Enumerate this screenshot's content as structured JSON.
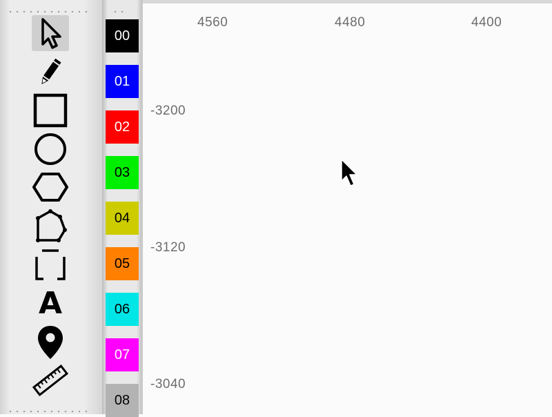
{
  "tools": [
    {
      "id": "select",
      "icon": "arrow-pointer-icon",
      "selected": true
    },
    {
      "id": "pencil",
      "icon": "pencil-icon",
      "selected": false
    },
    {
      "id": "rectangle",
      "icon": "square-icon",
      "selected": false
    },
    {
      "id": "circle",
      "icon": "circle-icon",
      "selected": false
    },
    {
      "id": "hexagon",
      "icon": "hexagon-icon",
      "selected": false
    },
    {
      "id": "polygon",
      "icon": "polygon-icon",
      "selected": false
    },
    {
      "id": "bracket",
      "icon": "bracket-icon",
      "selected": false
    },
    {
      "id": "text",
      "icon": "text-a-icon",
      "label": "A",
      "selected": false
    },
    {
      "id": "marker",
      "icon": "map-pin-icon",
      "selected": false
    },
    {
      "id": "measure",
      "icon": "ruler-icon",
      "selected": false
    }
  ],
  "palette": [
    {
      "label": "00",
      "bg": "#000000",
      "fg": "#ffffff"
    },
    {
      "label": "01",
      "bg": "#0000ff",
      "fg": "#ffffff"
    },
    {
      "label": "02",
      "bg": "#ff0000",
      "fg": "#ffffff"
    },
    {
      "label": "03",
      "bg": "#00ee00",
      "fg": "#000000"
    },
    {
      "label": "04",
      "bg": "#cccc00",
      "fg": "#000000"
    },
    {
      "label": "05",
      "bg": "#ff7f00",
      "fg": "#000000"
    },
    {
      "label": "06",
      "bg": "#00e5e5",
      "fg": "#000000"
    },
    {
      "label": "07",
      "bg": "#ff00ff",
      "fg": "#ffffff"
    },
    {
      "label": "08",
      "bg": "#b3b3b3",
      "fg": "#000000"
    }
  ],
  "ruler": {
    "x_ticks": [
      "4560",
      "4480",
      "4400"
    ],
    "y_ticks": [
      "-3200",
      "-3120",
      "-3040"
    ]
  },
  "canvas": {
    "cursor_icon": "mouse-cursor-icon"
  }
}
